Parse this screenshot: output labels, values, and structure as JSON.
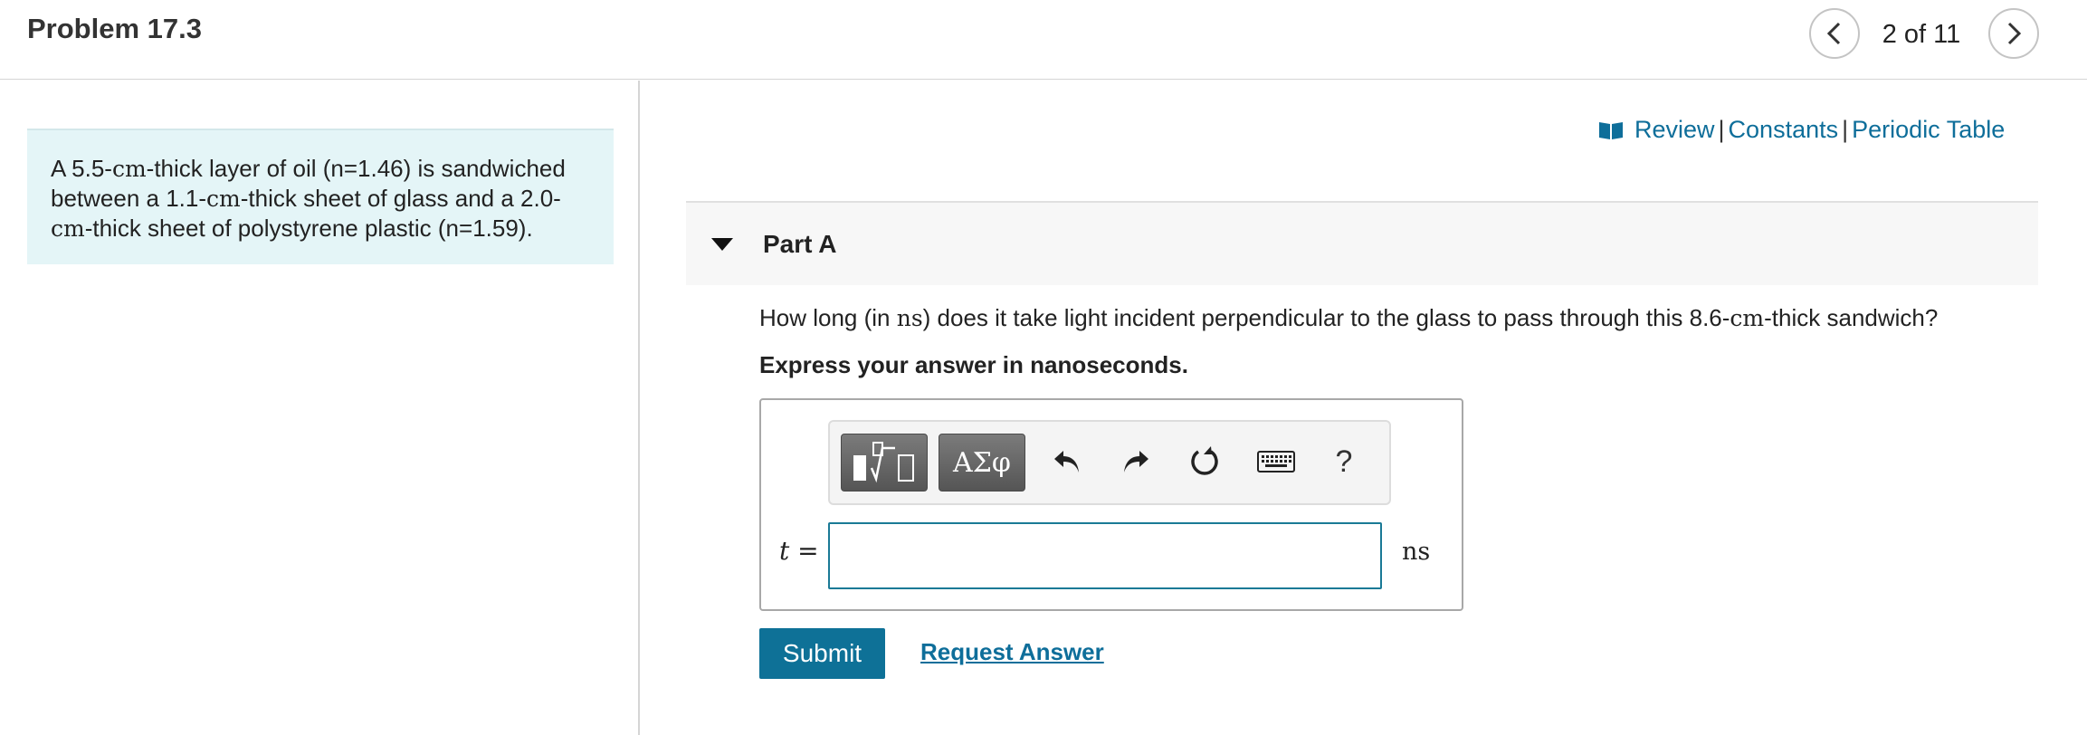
{
  "header": {
    "title": "Problem 17.3",
    "pager": "2 of 11"
  },
  "intro": {
    "segments": [
      "A 5.5-",
      "cm",
      "-thick layer of oil (n=1.46) is sandwiched between a 1.1-",
      "cm",
      "-thick sheet of glass and a 2.0-",
      "cm",
      "-thick sheet of polystyrene plastic (n=1.59)."
    ]
  },
  "resources": {
    "review": "Review",
    "constants": "Constants",
    "periodic_table": "Periodic Table",
    "separator": "|"
  },
  "part": {
    "title": "Part A",
    "question_segments": [
      "How long (in ",
      "ns",
      ") does it take light incident perpendicular to the glass to pass through this 8.6-",
      "cm",
      "-thick sandwich?"
    ],
    "instruction": "Express your answer in nanoseconds."
  },
  "toolbar": {
    "symbols_label": "ΑΣφ",
    "help_label": "?"
  },
  "answer": {
    "variable": "t",
    "equals": "=",
    "value": "",
    "unit": "ns"
  },
  "actions": {
    "submit": "Submit",
    "request_answer": "Request Answer"
  },
  "colors": {
    "accent": "#0e7197",
    "link": "#0e6e9a",
    "intro_bg": "#e4f5f7"
  }
}
